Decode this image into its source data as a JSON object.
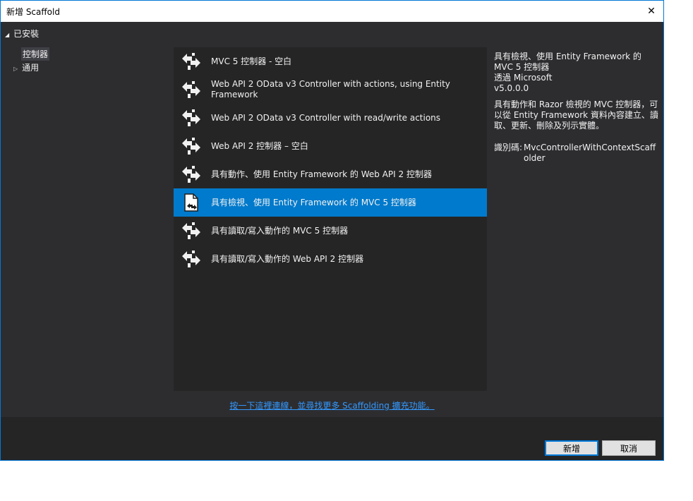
{
  "window": {
    "title": "新增 Scaffold",
    "close_symbol": "✕"
  },
  "installed_label": "已安裝",
  "tree": {
    "items": [
      "控制器",
      "通用"
    ]
  },
  "scaffolds": [
    {
      "label": "MVC 5 控制器 - 空白",
      "icon": "controller-icon"
    },
    {
      "label": "Web API 2 OData v3 Controller with actions, using Entity Framework",
      "icon": "controller-icon"
    },
    {
      "label": "Web API 2 OData v3 Controller with read/write actions",
      "icon": "controller-icon"
    },
    {
      "label": "Web API 2 控制器 – 空白",
      "icon": "controller-icon"
    },
    {
      "label": "具有動作、使用 Entity Framework 的 Web API 2 控制器",
      "icon": "controller-icon"
    },
    {
      "label": "具有檢視、使用 Entity Framework 的 MVC 5 控制器",
      "icon": "view-controller-icon",
      "selected": true
    },
    {
      "label": "具有讀取/寫入動作的 MVC 5 控制器",
      "icon": "controller-icon"
    },
    {
      "label": "具有讀取/寫入動作的 Web API 2 控制器",
      "icon": "controller-icon"
    }
  ],
  "details": {
    "title": "具有檢視、使用 Entity Framework 的 MVC 5 控制器",
    "author": "透過 Microsoft",
    "version": "v5.0.0.0",
    "description": "具有動作和 Razor 檢視的 MVC 控制器，可以從 Entity Framework 資料內容建立、讀取、更新、刪除及列示實體。",
    "id_label": "識別碼:",
    "id_value": "MvcControllerWithContextScaffolder"
  },
  "link_text": "按一下這裡連線，並尋找更多 Scaffolding 擴充功能。",
  "buttons": {
    "add": "新增",
    "cancel": "取消"
  },
  "colors": {
    "accent": "#007acc",
    "background": "#2d2d30",
    "list_background": "#252526",
    "link": "#3399ff"
  }
}
